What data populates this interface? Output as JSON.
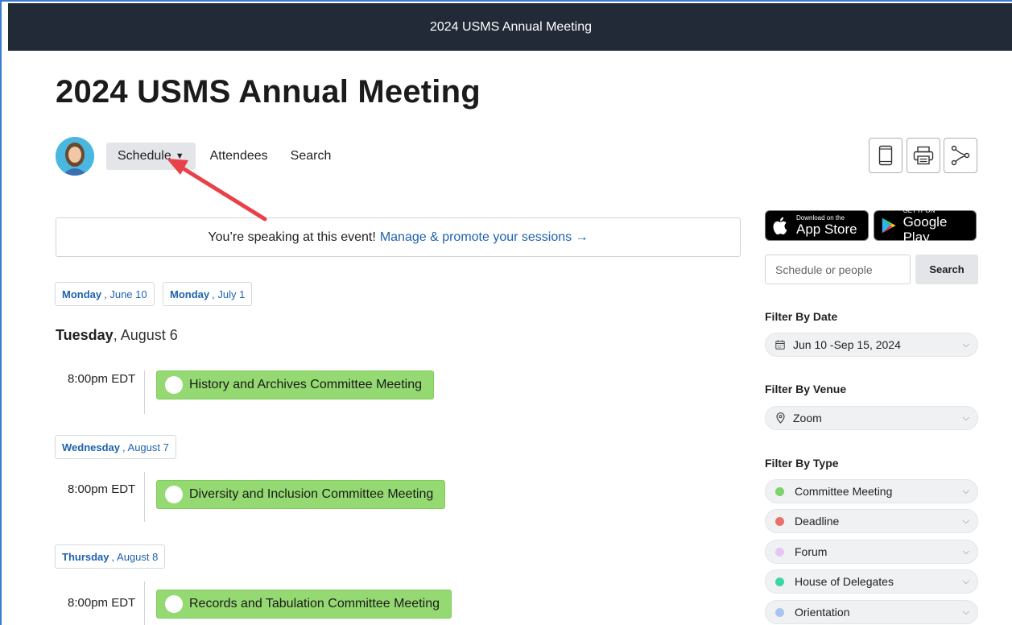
{
  "header": {
    "bar_title": "2024 USMS Annual Meeting",
    "page_title": "2024 USMS Annual Meeting"
  },
  "nav": {
    "schedule": "Schedule",
    "attendees": "Attendees",
    "search": "Search"
  },
  "speaker_notice": {
    "text": "You’re speaking at this event!",
    "link": "Manage & promote your sessions →"
  },
  "date_tabs": [
    {
      "day": "Monday",
      "date": ", June 10"
    },
    {
      "day": "Monday",
      "date": ", July 1"
    }
  ],
  "days": [
    {
      "day": "Tuesday",
      "date": ", August 6",
      "sessions": [
        {
          "time": "8:00pm EDT",
          "title": "History and Archives Committee Meeting"
        }
      ]
    },
    {
      "day": "Wednesday",
      "date": ", August 7",
      "sessions": [
        {
          "time": "8:00pm EDT",
          "title": "Diversity and Inclusion Committee Meeting"
        }
      ]
    },
    {
      "day": "Thursday",
      "date": ", August 8",
      "sessions": [
        {
          "time": "8:00pm EDT",
          "title": "Records and Tabulation Committee Meeting"
        }
      ]
    }
  ],
  "app_store": {
    "small": "Download on the",
    "big": "App Store"
  },
  "google_play": {
    "small": "GET IT ON",
    "big": "Google Play"
  },
  "search": {
    "placeholder": "Schedule or people",
    "button": "Search"
  },
  "filters": {
    "date_label": "Filter By Date",
    "date_value": "Jun 10 -Sep 15, 2024",
    "venue_label": "Filter By Venue",
    "venue_value": "Zoom",
    "type_label": "Filter By Type",
    "types": [
      {
        "name": "Committee Meeting",
        "color": "#7ed36a"
      },
      {
        "name": "Deadline",
        "color": "#e8716a"
      },
      {
        "name": "Forum",
        "color": "#e8c6f2"
      },
      {
        "name": "House of Delegates",
        "color": "#3fd6a6"
      },
      {
        "name": "Orientation",
        "color": "#a9c4f0"
      }
    ]
  },
  "colors": {
    "topbar": "#212a36",
    "link": "#1f62ae",
    "session_bg": "#94d971",
    "annotation_arrow": "#e8414a"
  }
}
